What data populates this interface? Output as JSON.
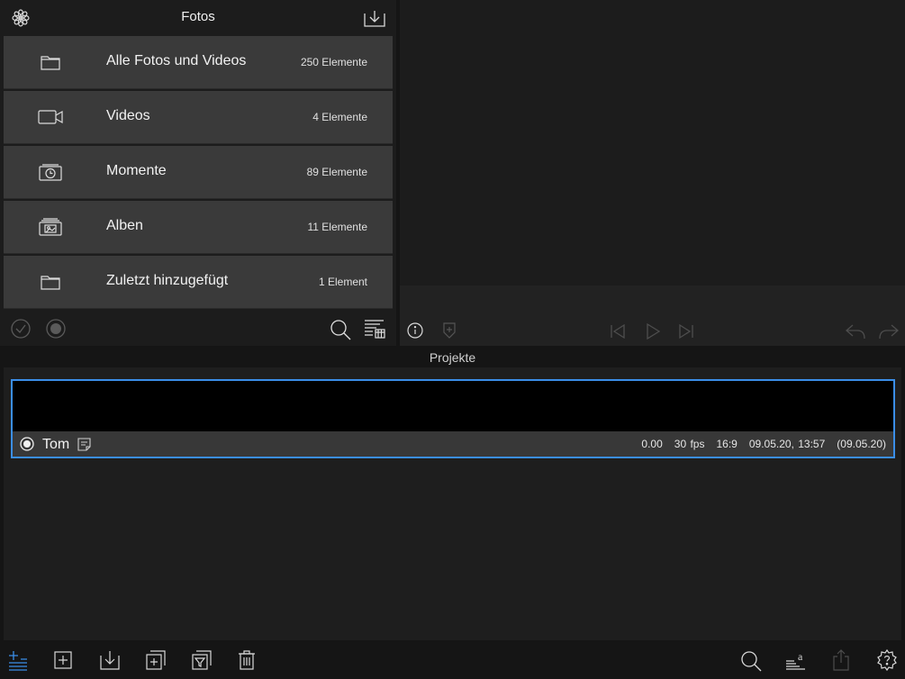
{
  "library": {
    "title": "Fotos",
    "items": [
      {
        "label": "Alle Fotos und Videos",
        "count": "250 Elemente",
        "icon": "folder-icon"
      },
      {
        "label": "Videos",
        "count": "4 Elemente",
        "icon": "video-camera-icon"
      },
      {
        "label": "Momente",
        "count": "89 Elemente",
        "icon": "moments-clock-icon"
      },
      {
        "label": "Alben",
        "count": "11 Elemente",
        "icon": "albums-icon"
      },
      {
        "label": "Zuletzt hinzugefügt",
        "count": "1 Element",
        "icon": "folder-icon"
      }
    ]
  },
  "projects": {
    "title": "Projekte",
    "items": [
      {
        "name": "Tom",
        "duration": "0.00",
        "fps": "30 fps",
        "aspect": "16:9",
        "created": "09.05.20, 13:57",
        "modified": "(09.05.20)"
      }
    ]
  },
  "colors": {
    "accent": "#3b8ee8",
    "panel": "#3a3a3a",
    "background": "#151515"
  }
}
